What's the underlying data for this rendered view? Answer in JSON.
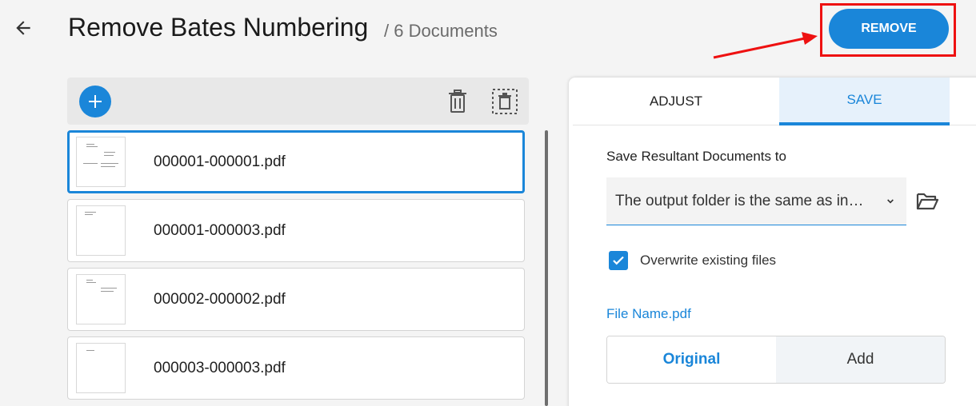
{
  "header": {
    "title": "Remove Bates Numbering",
    "doc_count": "/ 6 Documents",
    "remove_label": "REMOVE"
  },
  "files": [
    {
      "name": "000001-000001.pdf",
      "selected": true
    },
    {
      "name": "000001-000003.pdf",
      "selected": false
    },
    {
      "name": "000002-000002.pdf",
      "selected": false
    },
    {
      "name": "000003-000003.pdf",
      "selected": false
    }
  ],
  "panel": {
    "tabs": {
      "adjust": "ADJUST",
      "save": "SAVE",
      "active": "save"
    },
    "save_label": "Save Resultant Documents to",
    "folder_value": "The output folder is the same as in…",
    "overwrite_label": "Overwrite existing files",
    "overwrite_checked": true,
    "filename_label": "File Name.pdf",
    "name_options": {
      "original": "Original",
      "add": "Add",
      "selected": "original"
    }
  },
  "colors": {
    "accent": "#1a86d9",
    "highlight": "#ee1111"
  }
}
